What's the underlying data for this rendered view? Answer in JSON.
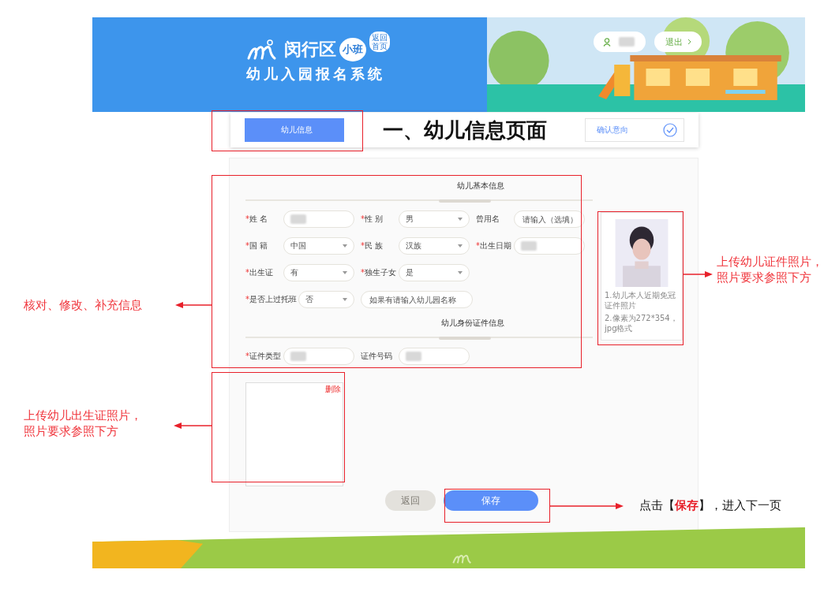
{
  "header": {
    "logo_title": "闵行区",
    "logo_badge": "小班",
    "subtitle": "幼儿入园报名系统",
    "home_bubble": "返回首页",
    "logout": "退出"
  },
  "steps": [
    {
      "label": "幼儿信息",
      "selected": true,
      "done": false
    },
    {
      "label": "确认意向",
      "selected": false,
      "done": true
    }
  ],
  "page_heading": "一、幼儿信息页面",
  "sections": [
    {
      "title": "幼儿基本信息",
      "rows": [
        [
          {
            "mark": "*",
            "label": "姓 名",
            "kind": "redacted"
          },
          {
            "mark": "*",
            "label": "性 别",
            "kind": "select",
            "value": "男"
          },
          {
            "label": "曾用名",
            "kind": "text",
            "placeholder": "请输入（选填）"
          }
        ],
        [
          {
            "mark": "*",
            "label": "国 籍",
            "kind": "select",
            "value": "中国"
          },
          {
            "mark": "*",
            "label": "民 族",
            "kind": "select",
            "value": "汉族"
          },
          {
            "mark": "*",
            "label": "出生日期",
            "kind": "redacted"
          }
        ],
        [
          {
            "mark": "*",
            "label": "出生证",
            "kind": "select",
            "value": "有"
          },
          {
            "mark": "*",
            "label": "独生子女",
            "kind": "select",
            "value": "是"
          }
        ],
        [
          {
            "mark": "*",
            "label": "是否上过托班",
            "kind": "select",
            "value": "否"
          },
          {
            "kind": "text",
            "placeholder": "如果有请输入幼儿园名称"
          }
        ]
      ]
    },
    {
      "title": "幼儿身份证件信息",
      "rows": [
        [
          {
            "mark": "*",
            "label": "证件类型",
            "kind": "redacted"
          },
          {
            "label": "证件号码",
            "kind": "redacted"
          }
        ]
      ]
    }
  ],
  "photo_upload": {
    "notes": [
      "1.幼儿本人近期免冠证件照片",
      "2.像素为272*354，jpg格式"
    ]
  },
  "birth_cert_upload": {
    "delete": "删除"
  },
  "buttons": [
    {
      "label": "返回",
      "disabled": true
    },
    {
      "label": "保存",
      "disabled": false
    }
  ],
  "annotations": {
    "form": "核对、修改、补充信息",
    "photo": [
      "上传幼儿证件照片，",
      "照片要求参照下方"
    ],
    "birth_cert": [
      "上传幼儿出生证照片，",
      "照片要求参照下方"
    ],
    "save": "点击【**保存**】，进入下一页"
  }
}
